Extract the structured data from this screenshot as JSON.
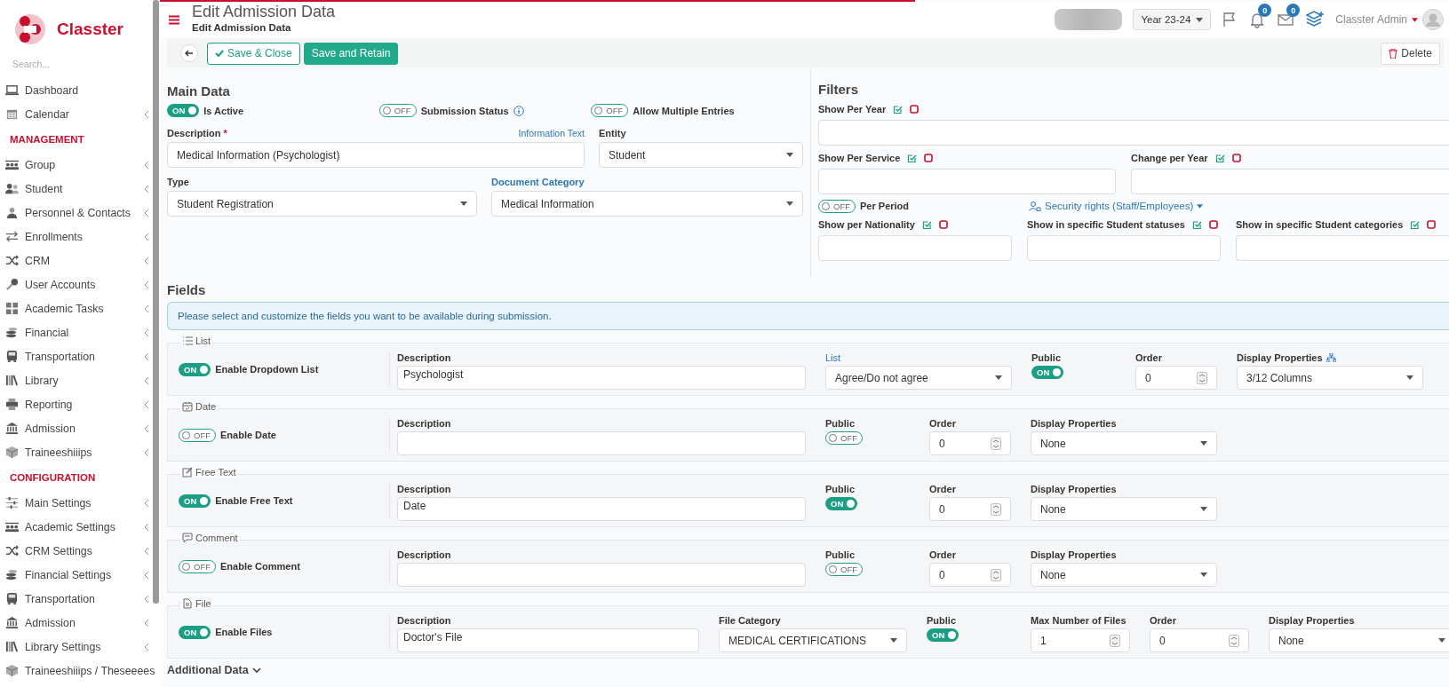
{
  "brand": {
    "name": "Classter"
  },
  "sidebar": {
    "search": {
      "placeholder": "Search..."
    },
    "sections": [
      {
        "items": [
          {
            "label": "Dashboard",
            "submenu": false
          },
          {
            "label": "Calendar",
            "submenu": true
          }
        ]
      },
      {
        "heading": "MANAGEMENT",
        "items": [
          {
            "label": "Group",
            "submenu": true
          },
          {
            "label": "Student",
            "submenu": true
          },
          {
            "label": "Personnel & Contacts",
            "submenu": true
          },
          {
            "label": "Enrollments",
            "submenu": true
          },
          {
            "label": "CRM",
            "submenu": true
          },
          {
            "label": "User Accounts",
            "submenu": true
          },
          {
            "label": "Academic Tasks",
            "submenu": true
          },
          {
            "label": "Financial",
            "submenu": true
          },
          {
            "label": "Transportation",
            "submenu": true
          },
          {
            "label": "Library",
            "submenu": true
          },
          {
            "label": "Reporting",
            "submenu": true
          },
          {
            "label": "Admission",
            "submenu": true
          },
          {
            "label": "Traineeshiiips",
            "submenu": true
          }
        ]
      },
      {
        "heading": "CONFIGURATION",
        "items": [
          {
            "label": "Main Settings",
            "submenu": true
          },
          {
            "label": "Academic Settings",
            "submenu": true
          },
          {
            "label": "CRM Settings",
            "submenu": true
          },
          {
            "label": "Financial Settings",
            "submenu": true
          },
          {
            "label": "Transportation",
            "submenu": true
          },
          {
            "label": "Admission",
            "submenu": true
          },
          {
            "label": "Library Settings",
            "submenu": true
          },
          {
            "label": "Traineeshiiips / Theseeees",
            "submenu": false
          }
        ]
      }
    ]
  },
  "header": {
    "title": "Edit Admission Data",
    "subtitle": "Edit Admission Data",
    "year": "Year 23-24",
    "notifications": "0",
    "messages": "0",
    "user": "Classter Admin"
  },
  "toolbar": {
    "buttons": [
      {
        "label": "Save & Close",
        "kind": "outline"
      },
      {
        "label": "Save and Retain",
        "kind": "solid"
      }
    ],
    "delete": "Delete"
  },
  "main_data": {
    "title": "Main Data",
    "toggles": [
      {
        "label": "Is Active",
        "on": true,
        "state": "ON",
        "info": false
      },
      {
        "label": "Submission Status",
        "on": false,
        "state": "OFF",
        "info": true
      },
      {
        "label": "Allow Multiple Entries",
        "on": false,
        "state": "OFF",
        "info": false
      }
    ],
    "description": {
      "label": "Description",
      "required": "*",
      "link": "Information Text",
      "value": "Medical Information (Psychologist)"
    },
    "entity": {
      "label": "Entity",
      "value": "Student"
    },
    "type": {
      "label": "Type",
      "value": "Student Registration"
    },
    "document_category": {
      "label": "Document Category",
      "value": "Medical Information"
    }
  },
  "filters": {
    "title": "Filters",
    "rows": [
      [
        {
          "label": "Show Per Year"
        }
      ],
      [
        {
          "label": "Show Per Service"
        },
        {
          "label": "Change per Year"
        }
      ],
      [
        {
          "label": "Show per Nationality"
        },
        {
          "label": "Show in specific Student statuses"
        },
        {
          "label": "Show in specific Student categories"
        }
      ]
    ],
    "per_period": {
      "label": "Per Period",
      "on": false,
      "state": "OFF"
    },
    "security_rights": "Security rights (Staff/Employees)"
  },
  "fields": {
    "title": "Fields",
    "info": "Please select and customize the fields you want to be available during submission.",
    "rows": [
      {
        "kind": "list",
        "legend": "List",
        "enable": {
          "label": "Enable Dropdown List",
          "on": true,
          "state": "ON"
        },
        "columns": [
          {
            "kind": "text",
            "label": "Description",
            "value": "Psychologist"
          },
          {
            "kind": "select",
            "label": "List",
            "link": true,
            "value": "Agree/Do not agree"
          },
          {
            "kind": "toggle",
            "label": "Public",
            "on": true,
            "state": "ON"
          },
          {
            "kind": "number",
            "label": "Order",
            "value": "0"
          },
          {
            "kind": "select",
            "label": "Display Properties",
            "icon": true,
            "value": "3/12 Columns"
          }
        ]
      },
      {
        "kind": "date",
        "legend": "Date",
        "enable": {
          "label": "Enable Date",
          "on": false,
          "state": "OFF"
        },
        "columns": [
          {
            "kind": "text",
            "label": "Description"
          },
          {
            "kind": "toggle",
            "label": "Public",
            "on": false,
            "state": "OFF"
          },
          {
            "kind": "number",
            "label": "Order",
            "value": "0"
          },
          {
            "kind": "select",
            "label": "Display Properties",
            "value": "None"
          }
        ]
      },
      {
        "kind": "text",
        "legend": "Free Text",
        "enable": {
          "label": "Enable Free Text",
          "on": true,
          "state": "ON"
        },
        "columns": [
          {
            "kind": "text",
            "label": "Description",
            "value": "Date"
          },
          {
            "kind": "toggle",
            "label": "Public",
            "on": true,
            "state": "ON"
          },
          {
            "kind": "number",
            "label": "Order",
            "value": "0"
          },
          {
            "kind": "select",
            "label": "Display Properties",
            "value": "None"
          }
        ]
      },
      {
        "kind": "comment",
        "legend": "Comment",
        "enable": {
          "label": "Enable Comment",
          "on": false,
          "state": "OFF"
        },
        "columns": [
          {
            "kind": "text",
            "label": "Description"
          },
          {
            "kind": "toggle",
            "label": "Public",
            "on": false,
            "state": "OFF"
          },
          {
            "kind": "number",
            "label": "Order",
            "value": "0"
          },
          {
            "kind": "select",
            "label": "Display Properties",
            "value": "None"
          }
        ]
      },
      {
        "kind": "file",
        "legend": "File",
        "enable": {
          "label": "Enable Files",
          "on": true,
          "state": "ON"
        },
        "columns": [
          {
            "kind": "text",
            "label": "Description",
            "value": "Doctor's File"
          },
          {
            "kind": "select",
            "label": "File Category",
            "value": "MEDICAL CERTIFICATIONS"
          },
          {
            "kind": "toggle",
            "label": "Public",
            "on": true,
            "state": "ON"
          },
          {
            "kind": "number",
            "label": "Max Number of Files",
            "value": "1"
          },
          {
            "kind": "number",
            "label": "Order",
            "value": "0"
          },
          {
            "kind": "select",
            "label": "Display Properties",
            "value": "None"
          }
        ]
      }
    ],
    "additional": "Additional Data"
  }
}
